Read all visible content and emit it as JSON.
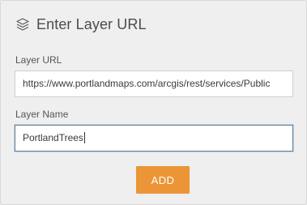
{
  "dialog": {
    "title": "Enter Layer URL",
    "icon": "layers-icon"
  },
  "url_field": {
    "label": "Layer URL",
    "value": "https://www.portlandmaps.com/arcgis/rest/services/Public"
  },
  "name_field": {
    "label": "Layer Name",
    "value": "PortlandTrees"
  },
  "actions": {
    "add_label": "ADD"
  },
  "colors": {
    "accent": "#ec9537",
    "panel_background": "#efefef",
    "focus_border": "#5f7f9c"
  }
}
